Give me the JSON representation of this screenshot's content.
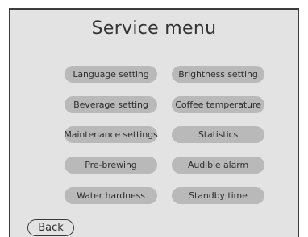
{
  "header": {
    "title": "Service menu"
  },
  "menu": {
    "items": [
      {
        "label": "Language setting"
      },
      {
        "label": "Brightness setting"
      },
      {
        "label": "Beverage setting"
      },
      {
        "label": "Coffee temperature"
      },
      {
        "label": "Maintenance settings"
      },
      {
        "label": "Statistics"
      },
      {
        "label": "Pre-brewing"
      },
      {
        "label": "Audible alarm"
      },
      {
        "label": "Water hardness"
      },
      {
        "label": "Standby time"
      }
    ]
  },
  "footer": {
    "back_label": "Back"
  },
  "colors": {
    "screen_background": "#e3e3e3",
    "button_fill": "#b9b9b9",
    "border": "#3c3c3c",
    "text": "#2e2e2e"
  }
}
